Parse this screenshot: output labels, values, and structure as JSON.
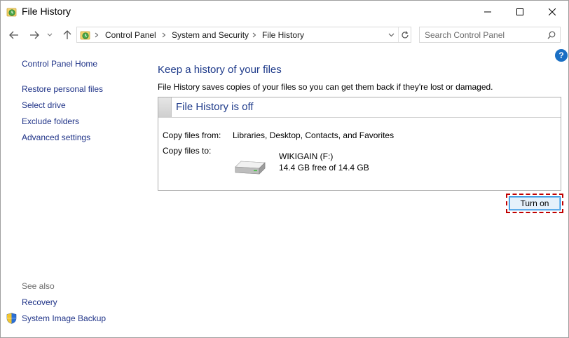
{
  "window": {
    "title": "File History",
    "icon": "file-history-icon",
    "controls": [
      "minimize-icon",
      "maximize-icon",
      "close-icon"
    ]
  },
  "navigation": {
    "back_icon": "arrow-left-icon",
    "forward_icon": "arrow-right-icon",
    "recent_icon": "chevron-down-icon",
    "up_icon": "arrow-up-icon"
  },
  "address_bar": {
    "breadcrumbs": [
      "Control Panel",
      "System and Security",
      "File History"
    ],
    "refresh_icon": "refresh-icon"
  },
  "search": {
    "placeholder": "Search Control Panel",
    "value": ""
  },
  "help": {
    "label": "?"
  },
  "left_pane": {
    "home": "Control Panel Home",
    "links": [
      "Restore personal files",
      "Select drive",
      "Exclude folders",
      "Advanced settings"
    ],
    "see_also_label": "See also",
    "see_also": [
      "Recovery",
      "System Image Backup"
    ]
  },
  "main": {
    "heading": "Keep a history of your files",
    "description": "File History saves copies of your files so you can get them back if they're lost or damaged.",
    "status_title": "File History is off",
    "copy_from_label": "Copy files from:",
    "copy_from_value": "Libraries, Desktop, Contacts, and Favorites",
    "copy_to_label": "Copy files to:",
    "drive_name": "WIKIGAIN (F:)",
    "drive_free": "14.4 GB free of 14.4 GB",
    "turn_on_label": "Turn on"
  },
  "colors": {
    "link": "#1e3287",
    "heading": "#1e3a8a",
    "highlight_border": "#c00000",
    "button_border": "#0078d7"
  }
}
